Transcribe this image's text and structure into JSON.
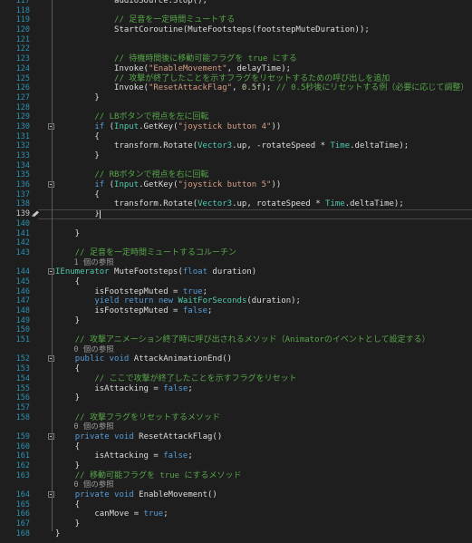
{
  "editor": {
    "lines": [
      {
        "n": "117",
        "t": [
          [
            "pl",
            "            audioSource.Stop();"
          ]
        ]
      },
      {
        "n": "118",
        "t": [
          [
            "pl",
            ""
          ]
        ]
      },
      {
        "n": "119",
        "t": [
          [
            "pl",
            "            "
          ],
          [
            "cm",
            "// 足音を一定時間ミュートする"
          ]
        ]
      },
      {
        "n": "120",
        "t": [
          [
            "pl",
            "            StartCoroutine(MuteFootsteps(footstepMuteDuration));"
          ]
        ]
      },
      {
        "n": "121",
        "t": [
          [
            "pl",
            ""
          ]
        ]
      },
      {
        "n": "122",
        "t": [
          [
            "pl",
            ""
          ]
        ]
      },
      {
        "n": "123",
        "t": [
          [
            "pl",
            "            "
          ],
          [
            "cm",
            "// 待機時間後に移動可能フラグを true にする"
          ]
        ]
      },
      {
        "n": "124",
        "t": [
          [
            "pl",
            "            Invoke("
          ],
          [
            "str",
            "\"EnableMovement\""
          ],
          [
            "pl",
            ", delayTime);"
          ]
        ]
      },
      {
        "n": "125",
        "t": [
          [
            "pl",
            "            "
          ],
          [
            "cm",
            "// 攻撃が終了したことを示すフラグをリセットするための呼び出しを追加"
          ]
        ]
      },
      {
        "n": "126",
        "t": [
          [
            "pl",
            "            Invoke("
          ],
          [
            "str",
            "\"ResetAttackFlag\""
          ],
          [
            "pl",
            ", "
          ],
          [
            "num",
            "0.5f"
          ],
          [
            "pl",
            "); "
          ],
          [
            "cm",
            "// 0.5秒後にリセットする例（必要に応じて調整）"
          ]
        ]
      },
      {
        "n": "127",
        "t": [
          [
            "pl",
            "        }"
          ]
        ]
      },
      {
        "n": "128",
        "t": [
          [
            "pl",
            ""
          ]
        ]
      },
      {
        "n": "129",
        "t": [
          [
            "pl",
            "        "
          ],
          [
            "cm",
            "// LBボタンで視点を左に回転"
          ]
        ]
      },
      {
        "n": "130",
        "t": [
          [
            "pl",
            "        "
          ],
          [
            "kw",
            "if"
          ],
          [
            "pl",
            " ("
          ],
          [
            "type",
            "Input"
          ],
          [
            "pl",
            ".GetKey("
          ],
          [
            "str",
            "\"joystick button 4\""
          ],
          [
            "pl",
            "))"
          ]
        ],
        "fold": true
      },
      {
        "n": "131",
        "t": [
          [
            "pl",
            "        {"
          ]
        ]
      },
      {
        "n": "132",
        "t": [
          [
            "pl",
            "            transform.Rotate("
          ],
          [
            "type",
            "Vector3"
          ],
          [
            "pl",
            ".up, -rotateSpeed * "
          ],
          [
            "type",
            "Time"
          ],
          [
            "pl",
            ".deltaTime);"
          ]
        ]
      },
      {
        "n": "133",
        "t": [
          [
            "pl",
            "        }"
          ]
        ]
      },
      {
        "n": "134",
        "t": [
          [
            "pl",
            ""
          ]
        ]
      },
      {
        "n": "135",
        "t": [
          [
            "pl",
            "        "
          ],
          [
            "cm",
            "// RBボタンで視点を右に回転"
          ]
        ]
      },
      {
        "n": "136",
        "t": [
          [
            "pl",
            "        "
          ],
          [
            "kw",
            "if"
          ],
          [
            "pl",
            " ("
          ],
          [
            "type",
            "Input"
          ],
          [
            "pl",
            ".GetKey("
          ],
          [
            "str",
            "\"joystick button 5\""
          ],
          [
            "pl",
            "))"
          ]
        ],
        "fold": true
      },
      {
        "n": "137",
        "t": [
          [
            "pl",
            "        {"
          ]
        ]
      },
      {
        "n": "138",
        "t": [
          [
            "pl",
            "            transform.Rotate("
          ],
          [
            "type",
            "Vector3"
          ],
          [
            "pl",
            ".up, rotateSpeed * "
          ],
          [
            "type",
            "Time"
          ],
          [
            "pl",
            ".deltaTime);"
          ]
        ]
      },
      {
        "n": "139",
        "t": [
          [
            "pl",
            "        }"
          ]
        ],
        "current": true
      },
      {
        "n": "140",
        "t": [
          [
            "pl",
            ""
          ]
        ]
      },
      {
        "n": "141",
        "t": [
          [
            "pl",
            "    }"
          ]
        ]
      },
      {
        "n": "142",
        "t": [
          [
            "pl",
            ""
          ]
        ]
      },
      {
        "n": "143",
        "t": [
          [
            "pl",
            "    "
          ],
          [
            "cm",
            "// 足音を一定時間ミュートするコルーチン"
          ]
        ]
      },
      {
        "lens": "1 個の参照",
        "indent": "    "
      },
      {
        "n": "144",
        "t": [
          [
            "type",
            "IEnumerator"
          ],
          [
            "pl",
            " MuteFootsteps("
          ],
          [
            "kw",
            "float"
          ],
          [
            "pl",
            " duration)"
          ]
        ],
        "fold": true
      },
      {
        "n": "145",
        "t": [
          [
            "pl",
            "    {"
          ]
        ]
      },
      {
        "n": "146",
        "t": [
          [
            "pl",
            "        isFootstepMuted = "
          ],
          [
            "kw",
            "true"
          ],
          [
            "pl",
            ";"
          ]
        ]
      },
      {
        "n": "147",
        "t": [
          [
            "pl",
            "        "
          ],
          [
            "kw",
            "yield"
          ],
          [
            "pl",
            " "
          ],
          [
            "kw",
            "return"
          ],
          [
            "pl",
            " "
          ],
          [
            "kw",
            "new"
          ],
          [
            "pl",
            " "
          ],
          [
            "type",
            "WaitForSeconds"
          ],
          [
            "pl",
            "(duration);"
          ]
        ]
      },
      {
        "n": "148",
        "t": [
          [
            "pl",
            "        isFootstepMuted = "
          ],
          [
            "kw",
            "false"
          ],
          [
            "pl",
            ";"
          ]
        ]
      },
      {
        "n": "149",
        "t": [
          [
            "pl",
            "    }"
          ]
        ]
      },
      {
        "n": "150",
        "t": [
          [
            "pl",
            ""
          ]
        ]
      },
      {
        "n": "151",
        "t": [
          [
            "pl",
            "    "
          ],
          [
            "cm",
            "// 攻撃アニメーション終了時に呼び出されるメソッド（Animatorのイベントとして設定する）"
          ]
        ]
      },
      {
        "lens": "0 個の参照",
        "indent": "    "
      },
      {
        "n": "152",
        "t": [
          [
            "pl",
            "    "
          ],
          [
            "kw",
            "public"
          ],
          [
            "pl",
            " "
          ],
          [
            "kw",
            "void"
          ],
          [
            "pl",
            " AttackAnimationEnd()"
          ]
        ],
        "fold": true
      },
      {
        "n": "153",
        "t": [
          [
            "pl",
            "    {"
          ]
        ]
      },
      {
        "n": "154",
        "t": [
          [
            "pl",
            "        "
          ],
          [
            "cm",
            "// ここで攻撃が終了したことを示すフラグをリセット"
          ]
        ]
      },
      {
        "n": "155",
        "t": [
          [
            "pl",
            "        isAttacking = "
          ],
          [
            "kw",
            "false"
          ],
          [
            "pl",
            ";"
          ]
        ]
      },
      {
        "n": "156",
        "t": [
          [
            "pl",
            "    }"
          ]
        ]
      },
      {
        "n": "157",
        "t": [
          [
            "pl",
            ""
          ]
        ]
      },
      {
        "n": "158",
        "t": [
          [
            "pl",
            "    "
          ],
          [
            "cm",
            "// 攻撃フラグをリセットするメソッド"
          ]
        ]
      },
      {
        "lens": "0 個の参照",
        "indent": "    "
      },
      {
        "n": "159",
        "t": [
          [
            "pl",
            "    "
          ],
          [
            "kw",
            "private"
          ],
          [
            "pl",
            " "
          ],
          [
            "kw",
            "void"
          ],
          [
            "pl",
            " ResetAttackFlag()"
          ]
        ],
        "fold": true
      },
      {
        "n": "160",
        "t": [
          [
            "pl",
            "    {"
          ]
        ]
      },
      {
        "n": "161",
        "t": [
          [
            "pl",
            "        isAttacking = "
          ],
          [
            "kw",
            "false"
          ],
          [
            "pl",
            ";"
          ]
        ]
      },
      {
        "n": "162",
        "t": [
          [
            "pl",
            "    }"
          ]
        ]
      },
      {
        "n": "163",
        "t": [
          [
            "pl",
            "    "
          ],
          [
            "cm",
            "// 移動可能フラグを true にするメソッド"
          ]
        ]
      },
      {
        "lens": "0 個の参照",
        "indent": "    "
      },
      {
        "n": "164",
        "t": [
          [
            "pl",
            "    "
          ],
          [
            "kw",
            "private"
          ],
          [
            "pl",
            " "
          ],
          [
            "kw",
            "void"
          ],
          [
            "pl",
            " EnableMovement()"
          ]
        ],
        "fold": true
      },
      {
        "n": "165",
        "t": [
          [
            "pl",
            "    {"
          ]
        ]
      },
      {
        "n": "166",
        "t": [
          [
            "pl",
            "        canMove = "
          ],
          [
            "kw",
            "true"
          ],
          [
            "pl",
            ";"
          ]
        ]
      },
      {
        "n": "167",
        "t": [
          [
            "pl",
            "    }"
          ]
        ]
      },
      {
        "n": "168",
        "t": [
          [
            "pl",
            "}"
          ]
        ]
      }
    ]
  },
  "colors": {
    "background": "#1e1e1e",
    "line_number": "#2b91af",
    "keyword": "#569cd6",
    "type": "#4ec9b0",
    "string": "#d69d85",
    "comment": "#57a64a",
    "number": "#b5cea8",
    "text": "#dcdcdc"
  },
  "icons": {
    "edit_marker": "pen-icon",
    "collapse": "collapse-toggle-icon"
  }
}
